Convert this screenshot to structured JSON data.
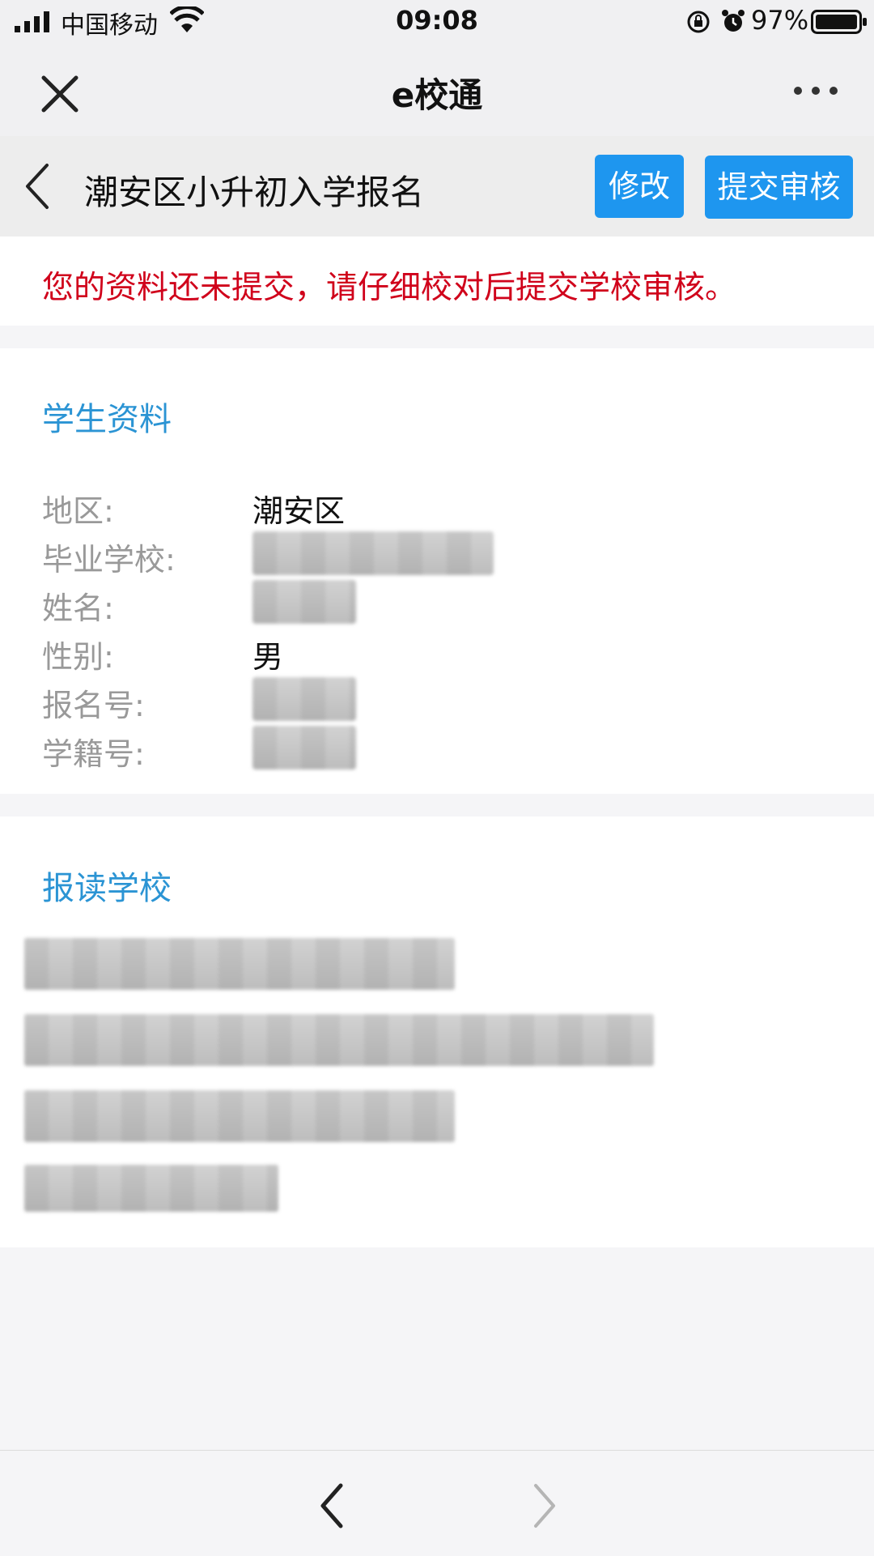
{
  "status_bar": {
    "carrier": "中国移动",
    "time": "09:08",
    "battery": "97%",
    "icons": [
      "signal-icon",
      "wifi-icon",
      "orientation-lock-icon",
      "alarm-icon",
      "battery-icon"
    ]
  },
  "nav_bar": {
    "title": "e校通",
    "close_icon": "close-icon",
    "more_icon": "more-icon"
  },
  "header": {
    "title": "潮安区小升初入学报名",
    "edit_label": "修改",
    "submit_label": "提交审核",
    "back_icon": "chevron-left-icon"
  },
  "notice": {
    "text": "您的资料还未提交，请仔细校对后提交学校审核。"
  },
  "student_info": {
    "heading": "学生资料",
    "fields": [
      {
        "label": "地区:",
        "value": "潮安区"
      },
      {
        "label": "毕业学校:",
        "value": ""
      },
      {
        "label": "姓名:",
        "value": ""
      },
      {
        "label": "性别:",
        "value": "男"
      },
      {
        "label": "报名号:",
        "value": ""
      },
      {
        "label": "学籍号:",
        "value": ""
      }
    ]
  },
  "school_section": {
    "heading": "报读学校"
  },
  "bottom_bar": {
    "back_icon": "chevron-left-icon",
    "forward_icon": "chevron-right-icon"
  },
  "colors": {
    "accent": "#1e96ef",
    "heading_blue": "#2b94d4",
    "warning_red": "#d0021b",
    "label_gray": "#999999"
  }
}
